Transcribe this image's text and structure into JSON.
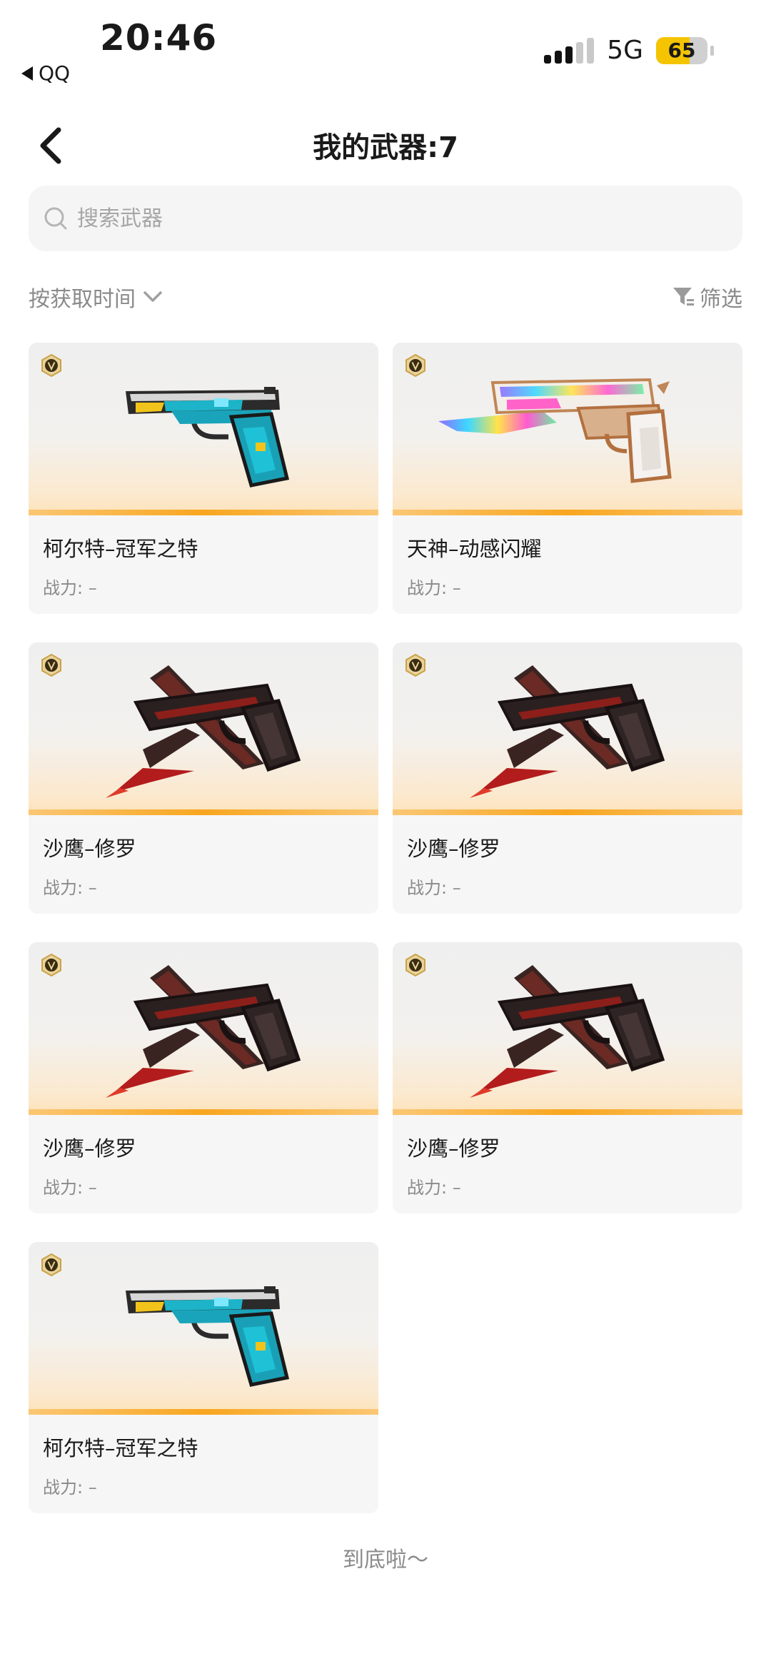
{
  "status_bar": {
    "time": "20:46",
    "back_app": "QQ",
    "network": "5G",
    "battery": "65"
  },
  "header": {
    "title": "我的武器:7"
  },
  "search": {
    "placeholder": "搜索武器"
  },
  "toolbar": {
    "sort_label": "按获取时间",
    "filter_label": "筛选"
  },
  "weapons": [
    {
      "name": "柯尔特–冠军之特",
      "power": "战力: –",
      "art": "colt-champion"
    },
    {
      "name": "天神–动感闪耀",
      "power": "战力: –",
      "art": "deagle-rainbow"
    },
    {
      "name": "沙鹰–修罗",
      "power": "战力: –",
      "art": "deagle-asura"
    },
    {
      "name": "沙鹰–修罗",
      "power": "战力: –",
      "art": "deagle-asura"
    },
    {
      "name": "沙鹰–修罗",
      "power": "战力: –",
      "art": "deagle-asura"
    },
    {
      "name": "沙鹰–修罗",
      "power": "战力: –",
      "art": "deagle-asura"
    },
    {
      "name": "柯尔特–冠军之特",
      "power": "战力: –",
      "art": "colt-champion"
    }
  ],
  "footer": {
    "end_text": "到底啦～"
  },
  "colors": {
    "accent": "#f8a61f",
    "vip_badge": "#c9a24a",
    "battery": "#f5c400"
  }
}
